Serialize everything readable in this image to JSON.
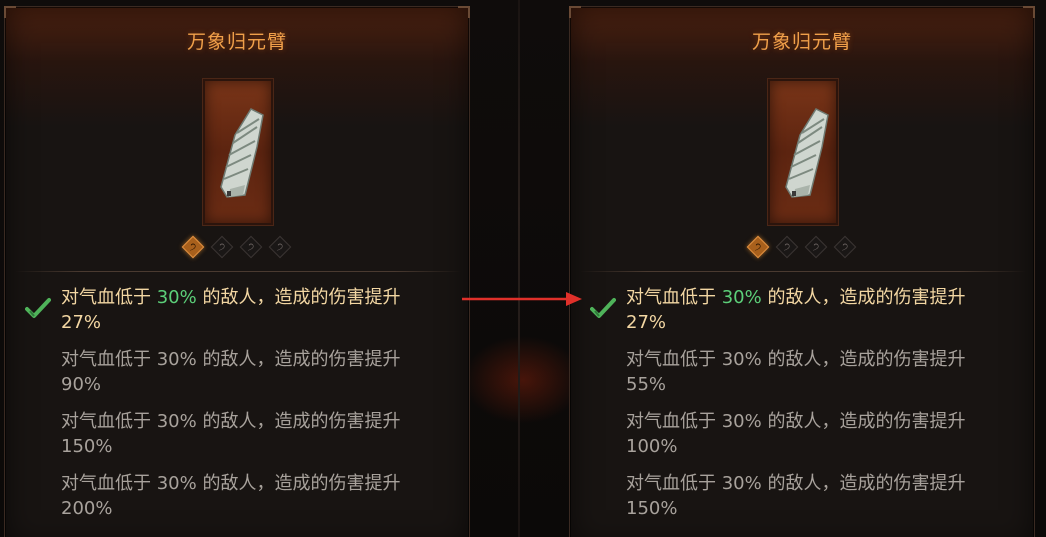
{
  "panels": [
    {
      "title": "万象归元臂",
      "effects": [
        {
          "prefix": "对气血低于 ",
          "pct": "30%",
          "suffix": " 的敌人，造成的伤害提升",
          "value": "27%",
          "active": true
        },
        {
          "prefix": "对气血低于 ",
          "pct": "30%",
          "suffix": " 的敌人，造成的伤害提升",
          "value": "90%",
          "active": false
        },
        {
          "prefix": "对气血低于 ",
          "pct": "30%",
          "suffix": " 的敌人，造成的伤害提升",
          "value": "150%",
          "active": false
        },
        {
          "prefix": "对气血低于 ",
          "pct": "30%",
          "suffix": " 的敌人，造成的伤害提升",
          "value": "200%",
          "active": false
        }
      ],
      "gems": [
        {
          "symbol": "੭",
          "active": true
        },
        {
          "symbol": "੭",
          "active": false
        },
        {
          "symbol": "੭",
          "active": false
        },
        {
          "symbol": "੭",
          "active": false
        }
      ]
    },
    {
      "title": "万象归元臂",
      "effects": [
        {
          "prefix": "对气血低于 ",
          "pct": "30%",
          "suffix": " 的敌人，造成的伤害提升",
          "value": "27%",
          "active": true
        },
        {
          "prefix": "对气血低于 ",
          "pct": "30%",
          "suffix": " 的敌人，造成的伤害提升",
          "value": "55%",
          "active": false
        },
        {
          "prefix": "对气血低于 ",
          "pct": "30%",
          "suffix": " 的敌人，造成的伤害提升",
          "value": "100%",
          "active": false
        },
        {
          "prefix": "对气血低于 ",
          "pct": "30%",
          "suffix": " 的敌人，造成的伤害提升",
          "value": "150%",
          "active": false
        }
      ],
      "gems": [
        {
          "symbol": "੭",
          "active": true
        },
        {
          "symbol": "੭",
          "active": false
        },
        {
          "symbol": "੭",
          "active": false
        },
        {
          "symbol": "੭",
          "active": false
        }
      ]
    }
  ],
  "icons": {
    "item": "bandaged-arm-guard-icon",
    "check": "checkmark-icon",
    "arrow": "red-arrow-icon"
  },
  "colors": {
    "title": "#f0a04a",
    "active_text": "#f3d7a3",
    "highlight_pct": "#5ccf79",
    "dim_text": "#a8a29c",
    "check": "#4fb35a",
    "arrow": "#e0302a"
  }
}
